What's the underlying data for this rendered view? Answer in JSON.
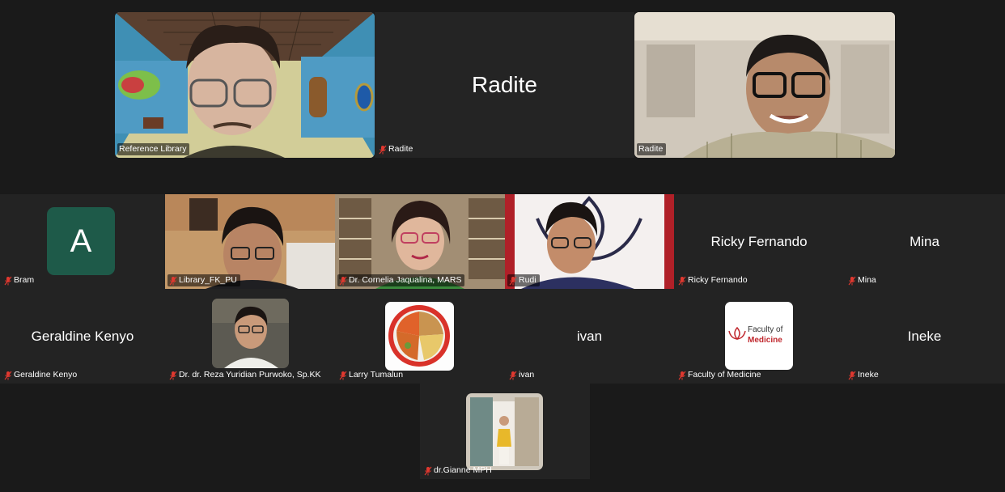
{
  "top_row": [
    {
      "id": "reference-library",
      "label": "Reference Library",
      "muted": false
    },
    {
      "id": "radite-name",
      "display_name": "Radite",
      "label": "Radite",
      "muted": true
    },
    {
      "id": "radite-video",
      "label": "Radite",
      "muted": false
    }
  ],
  "grid": [
    {
      "id": "bram",
      "label": "Bram",
      "muted": true,
      "avatar_letter": "A"
    },
    {
      "id": "library-fk-pu",
      "label": "Library_FK_PU",
      "muted": true
    },
    {
      "id": "cornelia",
      "label": "Dr. Cornelia Jaqualina, MARS",
      "muted": true
    },
    {
      "id": "rudi",
      "label": "Rudi",
      "muted": true
    },
    {
      "id": "ricky",
      "display_name": "Ricky Fernando",
      "label": "Ricky Fernando",
      "muted": true
    },
    {
      "id": "mina",
      "display_name": "Mina",
      "label": "Mina",
      "muted": true
    },
    {
      "id": "geraldine",
      "display_name": "Geraldine Kenyo",
      "label": "Geraldine Kenyo",
      "muted": true
    },
    {
      "id": "reza",
      "label": "Dr. dr. Reza Yuridian Purwoko, Sp.KK",
      "muted": true
    },
    {
      "id": "larry",
      "label": "Larry Tumalun",
      "muted": true
    },
    {
      "id": "ivan",
      "display_name": "ivan",
      "label": "ivan",
      "muted": true
    },
    {
      "id": "faculty",
      "label": "Faculty of Medicine",
      "muted": true,
      "logo_line1": "Faculty of",
      "logo_line2": "Medicine"
    },
    {
      "id": "ineke",
      "display_name": "Ineke",
      "label": "Ineke",
      "muted": true
    },
    {
      "id": "gianne",
      "label": "dr.Gianne MPH",
      "muted": true
    }
  ],
  "colors": {
    "background": "#1a1a1a",
    "tile": "#242424",
    "muted_mic": "#e0382f",
    "avatar_green": "#1e5a49",
    "faculty_red": "#c0272d"
  }
}
